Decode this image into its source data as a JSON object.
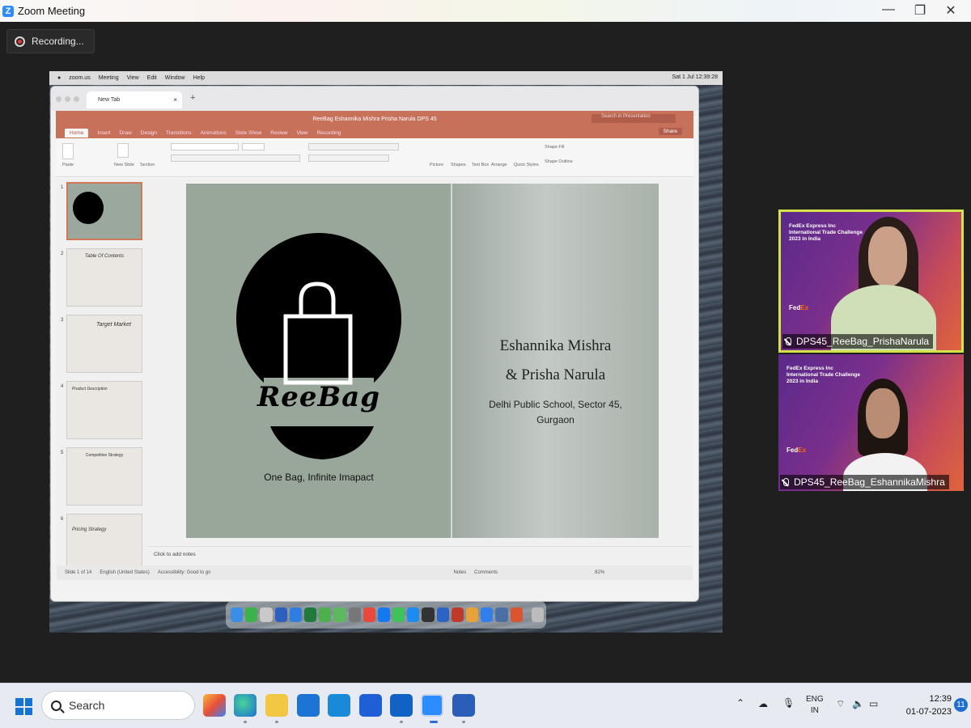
{
  "window": {
    "title": "Zoom Meeting",
    "minimize": "—",
    "restore": "❐",
    "close": "✕"
  },
  "recording": {
    "label": "Recording..."
  },
  "mac_menu": [
    "zoom.us",
    "Meeting",
    "View",
    "Edit",
    "Window",
    "Help"
  ],
  "mac_clock": "Sat 1 Jul 12:39:28",
  "browser": {
    "tab_label": "New Tab",
    "tab_close": "×",
    "new_tab": "+"
  },
  "powerpoint": {
    "doc_title": "ReeBag Eshannika Mishra Prisha Narula DPS 45",
    "search_placeholder": "Search in Presentation",
    "share_label": "Share",
    "ribbon_tabs": [
      "Home",
      "Insert",
      "Draw",
      "Design",
      "Transitions",
      "Animations",
      "Slide Show",
      "Review",
      "View",
      "Recording"
    ],
    "ribbon_groups": [
      "Paste",
      "New Slide",
      "Section",
      "Picture",
      "Shapes",
      "Text Box",
      "Arrange",
      "Quick Styles",
      "Shape Fill",
      "Shape Outline"
    ],
    "thumbnails": [
      {
        "num": "1",
        "caption": ""
      },
      {
        "num": "2",
        "caption": "Table Of Contents"
      },
      {
        "num": "3",
        "caption": "Target Market"
      },
      {
        "num": "4",
        "caption": "Product Description"
      },
      {
        "num": "5",
        "caption": "Competitive Strategy"
      },
      {
        "num": "6",
        "caption": "Pricing Strategy"
      }
    ],
    "notes_placeholder": "Click to add notes",
    "status": {
      "slide": "Slide 1 of 14",
      "language": "English (United States)",
      "accessibility": "Accessibility: Good to go",
      "notes": "Notes",
      "comments": "Comments",
      "zoom": "82%"
    }
  },
  "slide": {
    "logo_text": "ReeBag",
    "tagline": "One Bag, Infinite Imapact",
    "names_line1": "Eshannika Mishra",
    "names_line2": "& Prisha Narula",
    "school_line1": "Delhi Public School, Sector 45,",
    "school_line2": "Gurgaon",
    "colors": {
      "left_panel": "#99a69a",
      "logo": "#000000"
    }
  },
  "participants": [
    {
      "name": "DPS45_ReeBag_PrishaNarula",
      "active": true
    },
    {
      "name": "DPS45_ReeBag_EshannikaMishra",
      "active": false
    }
  ],
  "participant_banner": {
    "line1": "FedEx Express Inc",
    "line2": "International Trade Challenge",
    "line3": "2023 in India",
    "brand_a": "Fed",
    "brand_b": "Ex"
  },
  "taskbar": {
    "search_placeholder": "Search",
    "language_line1": "ENG",
    "language_line2": "IN",
    "time": "12:39",
    "date": "01-07-2023",
    "notifications": "11"
  }
}
